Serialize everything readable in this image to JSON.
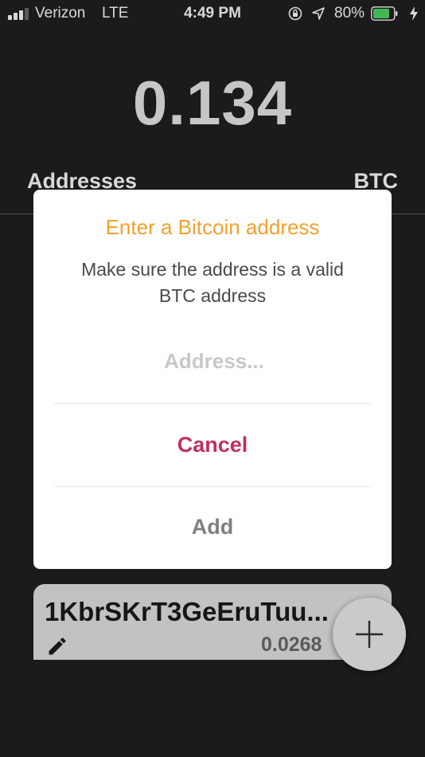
{
  "status_bar": {
    "carrier": "Verizon",
    "network": "LTE",
    "time": "4:49 PM",
    "battery_percent": "80%",
    "battery_level": 0.8,
    "icons": [
      "signal-icon",
      "orientation-lock-icon",
      "location-arrow-icon",
      "battery-icon",
      "charging-bolt-icon"
    ]
  },
  "wallet": {
    "balance": "0.134",
    "tab_label": "Addresses",
    "currency": "BTC"
  },
  "dialog": {
    "title": "Enter a Bitcoin address",
    "message": "Make sure the address is a valid BTC address",
    "input_placeholder": "Address...",
    "input_value": "",
    "cancel_label": "Cancel",
    "add_label": "Add"
  },
  "addresses": [
    {
      "address": "1KbrSKrT3GeEruTuu...",
      "balance": "0.0268",
      "icon": "pencil-edit-icon"
    }
  ],
  "fab": {
    "icon": "plus-icon"
  },
  "colors": {
    "background": "#202020",
    "dialog_title": "#f3a12c",
    "cancel": "#c0305e",
    "add": "#7f7f7f",
    "battery": "#4cd964"
  }
}
